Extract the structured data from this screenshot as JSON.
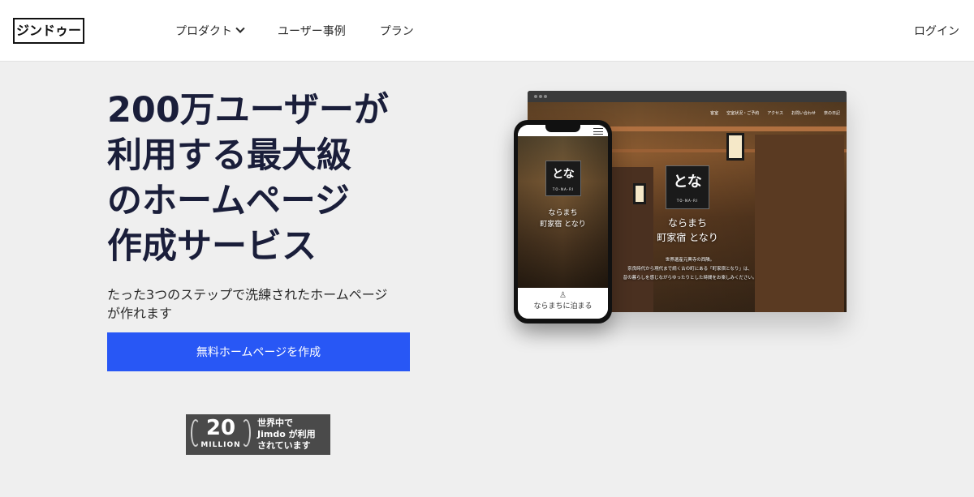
{
  "header": {
    "logo": "ジンドゥー",
    "nav": [
      {
        "label": "プロダクト"
      },
      {
        "label": "ユーザー事例"
      },
      {
        "label": "プラン"
      }
    ],
    "login": "ログイン"
  },
  "hero": {
    "title": "200万ユーザーが\n利用する最大級\nのホームページ\n作成サービス",
    "subtitle": "たった3つのステップで洗練されたホームページが作れます",
    "cta": "無料ホームページを作成"
  },
  "badge": {
    "number": "20",
    "unit": "MILLION",
    "line1": "世界中で",
    "line2": "Jimdo が利用",
    "line3": "されています"
  },
  "mockup": {
    "desktop": {
      "nav": [
        "客室",
        "空室状況・ご予約",
        "アクセス",
        "お問い合わせ",
        "奈の日記"
      ],
      "emblem_sub": "TO-NA-RI",
      "title_line1": "ならまち",
      "title_line2": "町家宿 となり",
      "desc_line1": "世界遺産元興寺の西隣。",
      "desc_line2": "奈良時代から現代まで続く古の町にある「町家宿となり」は、",
      "desc_line3": "昔の暮らしを感じながらゆったりとした時間をお楽しみください。"
    },
    "phone": {
      "emblem_sub": "TO-NA-RI",
      "title_line1": "ならまち",
      "title_line2": "町家宿 となり",
      "bottom_label": "ならまちに泊まる"
    }
  }
}
